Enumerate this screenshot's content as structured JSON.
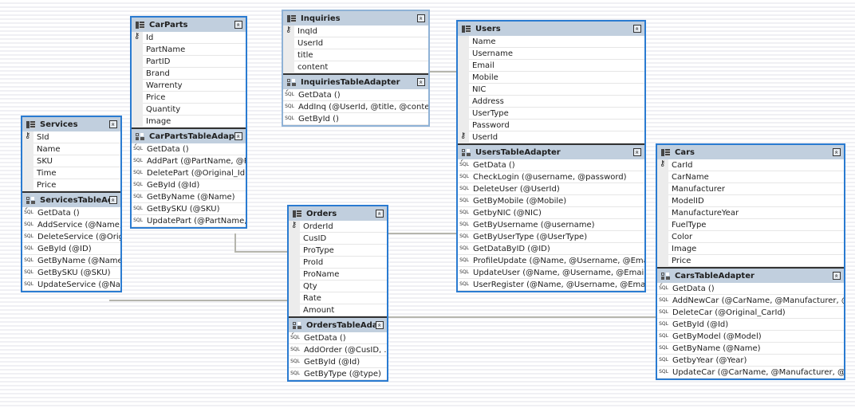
{
  "diagram": {
    "tables": [
      {
        "id": "carparts",
        "name": "CarParts",
        "primary_key": "Id",
        "columns": [
          "Id",
          "PartName",
          "PartID",
          "Brand",
          "Warrenty",
          "Price",
          "Quantity",
          "Image"
        ],
        "adapter": {
          "name": "CarPartsTableAdapter",
          "methods": [
            "GetData ()",
            "AddPart (@PartName, @Pa...",
            "DeletePart (@Original_Id)",
            "GeById (@Id)",
            "GetByName (@Name)",
            "GetBySKU (@SKU)",
            "UpdatePart (@PartName, ..."
          ]
        }
      },
      {
        "id": "services",
        "name": "Services",
        "primary_key": "SId",
        "columns": [
          "SId",
          "Name",
          "SKU",
          "Time",
          "Price"
        ],
        "adapter": {
          "name": "ServicesTableAdapt",
          "methods": [
            "GetData ()",
            "AddService (@Name, ...",
            "DeleteService (@Origi...",
            "GeById (@ID)",
            "GetByName (@Name)",
            "GetBySKU (@SKU)",
            "UpdateService (@Na..."
          ]
        }
      },
      {
        "id": "inquiries",
        "name": "Inquiries",
        "primary_key": "InqId",
        "columns": [
          "InqId",
          "UserId",
          "title",
          "content"
        ],
        "adapter": {
          "name": "InquiriesTableAdapter",
          "methods": [
            "GetData ()",
            "AddInq (@UserId, @title, @content)",
            "GetById ()"
          ]
        }
      },
      {
        "id": "users",
        "name": "Users",
        "primary_key": "UserId",
        "columns": [
          "Name",
          "Username",
          "Email",
          "Mobile",
          "NIC",
          "Address",
          "UserType",
          "Password",
          "UserId"
        ],
        "adapter": {
          "name": "UsersTableAdapter",
          "methods": [
            "GetData ()",
            "CheckLogin (@username, @password)",
            "DeleteUser (@UserId)",
            "GetByMobile (@Mobile)",
            "GetbyNIC (@NIC)",
            "GetByUsername (@username)",
            "GetByUserType (@UserType)",
            "GetDataByID (@ID)",
            "ProfileUpdate (@Name, @Username, @Email, @...",
            "UpdateUser (@Name, @Username, @Email, @M...",
            "UserRegister (@Name, @Username, @Email, @M..."
          ]
        }
      },
      {
        "id": "orders",
        "name": "Orders",
        "primary_key": "OrderId",
        "columns": [
          "OrderId",
          "CusID",
          "ProType",
          "ProId",
          "ProName",
          "Qty",
          "Rate",
          "Amount"
        ],
        "adapter": {
          "name": "OrdersTableAdapter",
          "methods": [
            "GetData ()",
            "AddOrder (@CusID, ...",
            "GetById (@Id)",
            "GetByType (@type)"
          ]
        }
      },
      {
        "id": "cars",
        "name": "Cars",
        "primary_key": "CarId",
        "columns": [
          "CarId",
          "CarName",
          "Manufacturer",
          "ModelID",
          "ManufactureYear",
          "FuelType",
          "Color",
          "Image",
          "Price"
        ],
        "adapter": {
          "name": "CarsTableAdapter",
          "methods": [
            "GetData ()",
            "AddNewCar (@CarName, @Manufacturer, @Ma...",
            "DeleteCar (@Original_CarId)",
            "GetById (@Id)",
            "GetByModel (@Model)",
            "GetByName (@Name)",
            "GetbyYear (@Year)",
            "UpdateCar (@CarName, @Manufacturer, @Man..."
          ]
        }
      }
    ],
    "relations": [
      {
        "from": "inquiries",
        "to": "users"
      },
      {
        "from": "carparts",
        "to": "orders"
      },
      {
        "from": "services",
        "to": "orders"
      },
      {
        "from": "orders",
        "to": "users"
      },
      {
        "from": "orders",
        "to": "cars"
      }
    ],
    "icons": {
      "table": "table-icon",
      "adapter": "table-adapter-icon",
      "key": "primary-key-icon",
      "query": "sql-query-icon",
      "collapse": "collapse-chevron-icon"
    },
    "glyphs": {
      "collapse": "»",
      "key": "⚷",
      "sql": "SQL"
    },
    "colors": {
      "selected_border": "#2a7bd1",
      "header_bg": "#c1cfde",
      "relation_line": "#b5b5ad"
    }
  }
}
